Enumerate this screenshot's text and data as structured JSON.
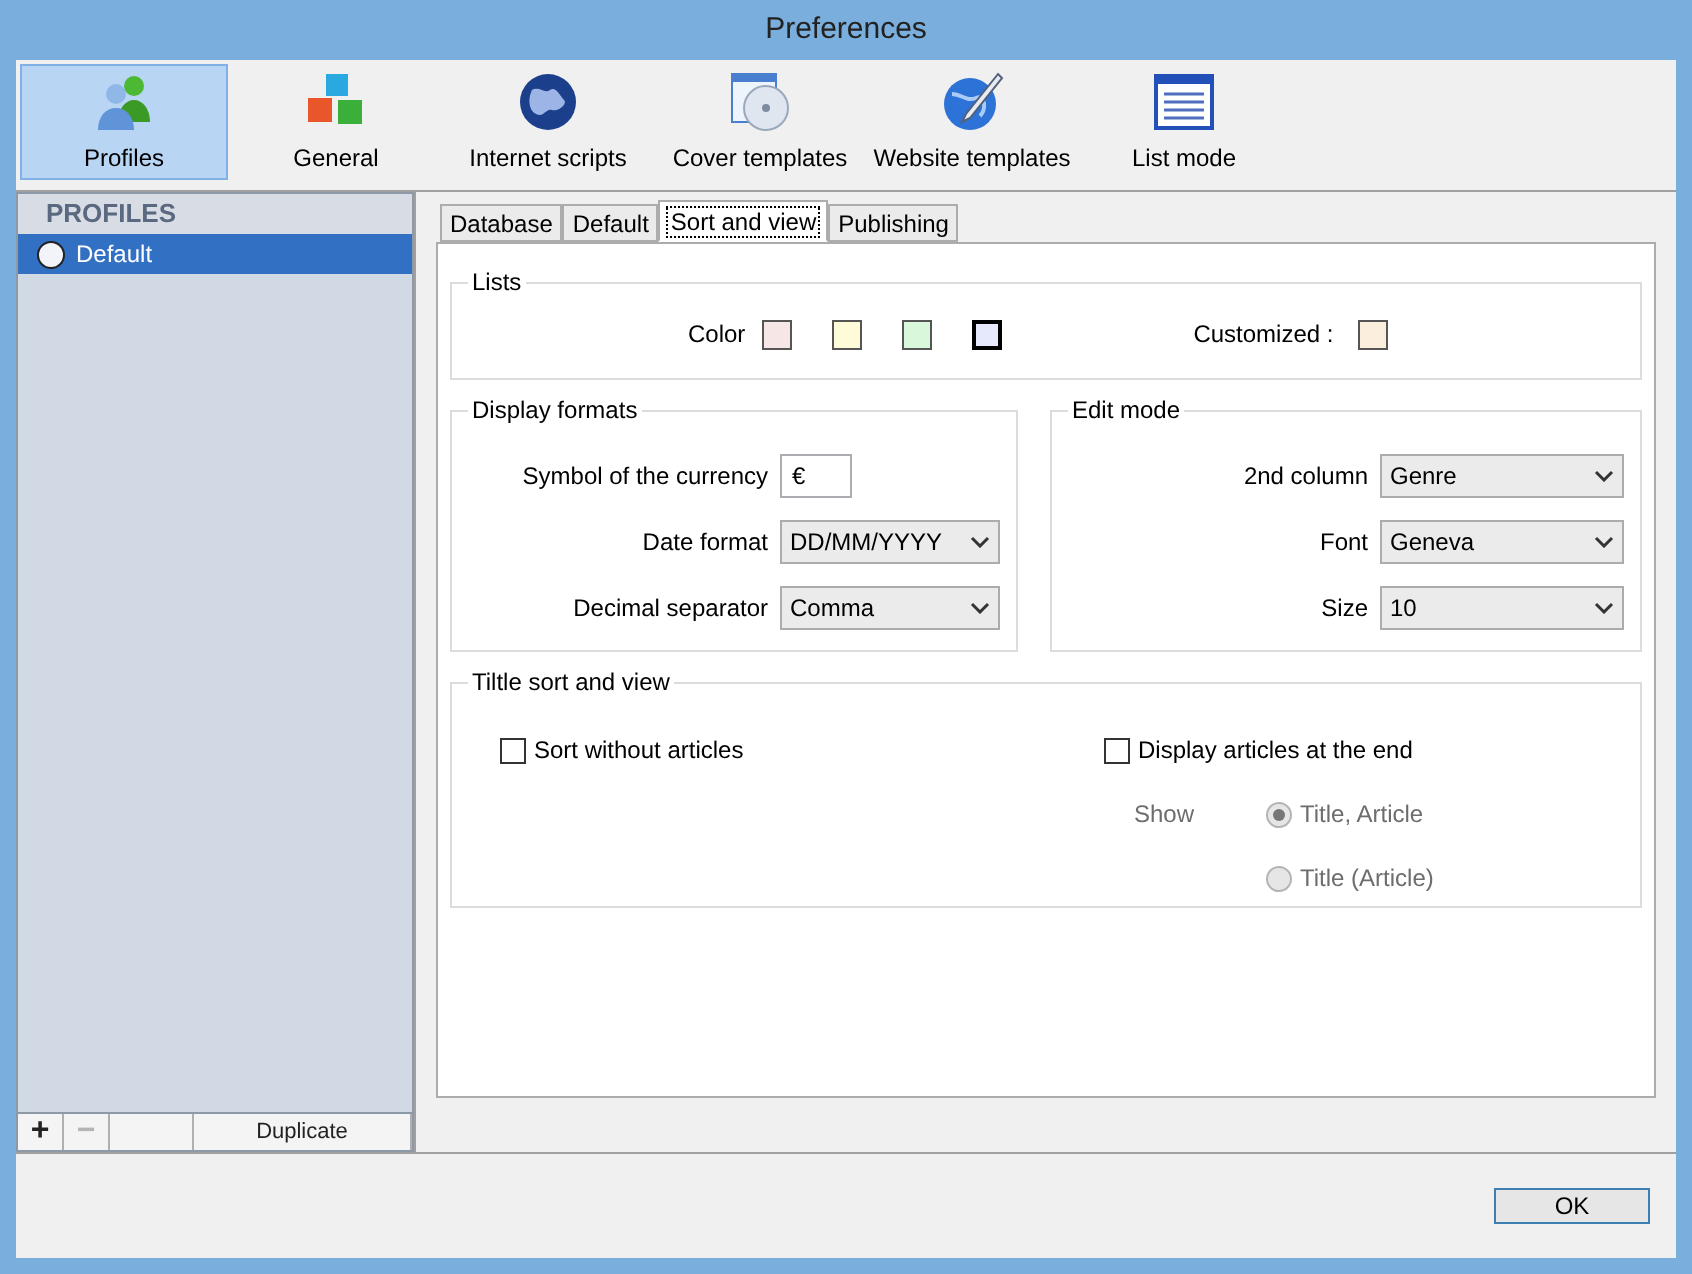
{
  "window": {
    "title": "Preferences"
  },
  "toolbar": [
    {
      "label": "Profiles",
      "selected": true
    },
    {
      "label": "General",
      "selected": false
    },
    {
      "label": "Internet scripts",
      "selected": false
    },
    {
      "label": "Cover templates",
      "selected": false
    },
    {
      "label": "Website templates",
      "selected": false
    },
    {
      "label": "List mode",
      "selected": false
    }
  ],
  "sidebar": {
    "header": "PROFILES",
    "items": [
      {
        "label": "Default",
        "selected": true
      }
    ],
    "buttons": [
      {
        "label": "+",
        "disabled": false
      },
      {
        "label": "−",
        "disabled": true
      },
      {
        "label": "Duplicate",
        "disabled": false
      }
    ]
  },
  "tabs": [
    {
      "label": "Database",
      "selected": false
    },
    {
      "label": "Default",
      "selected": false
    },
    {
      "label": "Sort and view",
      "selected": true
    },
    {
      "label": "Publishing",
      "selected": false
    }
  ],
  "lists": {
    "title": "Lists",
    "color_label": "Color",
    "swatches": [
      {
        "kind": "preset",
        "color": "#f7e6e6",
        "selected": false
      },
      {
        "kind": "preset",
        "color": "#fdfbd8",
        "selected": false
      },
      {
        "kind": "preset",
        "color": "#d9f7da",
        "selected": false
      },
      {
        "kind": "preset",
        "color": "#e6e9fb",
        "selected": true
      },
      {
        "kind": "custom",
        "color": "#fbeedc",
        "selected": false
      }
    ],
    "customized_label": "Customized :"
  },
  "display_formats": {
    "title": "Display formats",
    "rows": [
      {
        "label": "Symbol of the currency",
        "kind": "text",
        "value": "€"
      },
      {
        "label": "Date format",
        "kind": "select",
        "value": "DD/MM/YYYY"
      },
      {
        "label": "Decimal separator",
        "kind": "select",
        "value": "Comma"
      }
    ]
  },
  "edit_mode": {
    "title": "Edit mode",
    "rows": [
      {
        "label": "2nd column",
        "kind": "select",
        "value": "Genre"
      },
      {
        "label": "Font",
        "kind": "select",
        "value": "Geneva"
      },
      {
        "label": "Size",
        "kind": "select",
        "value": "10"
      }
    ]
  },
  "title_sort": {
    "title": "Tiltle sort and view",
    "checkboxes": [
      {
        "label": "Sort without articles",
        "checked": false
      },
      {
        "label": "Display articles at the end",
        "checked": false
      }
    ],
    "show_label": "Show",
    "radios": [
      {
        "label": "Title, Article",
        "selected": true,
        "disabled": true
      },
      {
        "label": "Title (Article)",
        "selected": false,
        "disabled": true
      }
    ]
  },
  "buttons": [
    {
      "label": "OK"
    }
  ]
}
